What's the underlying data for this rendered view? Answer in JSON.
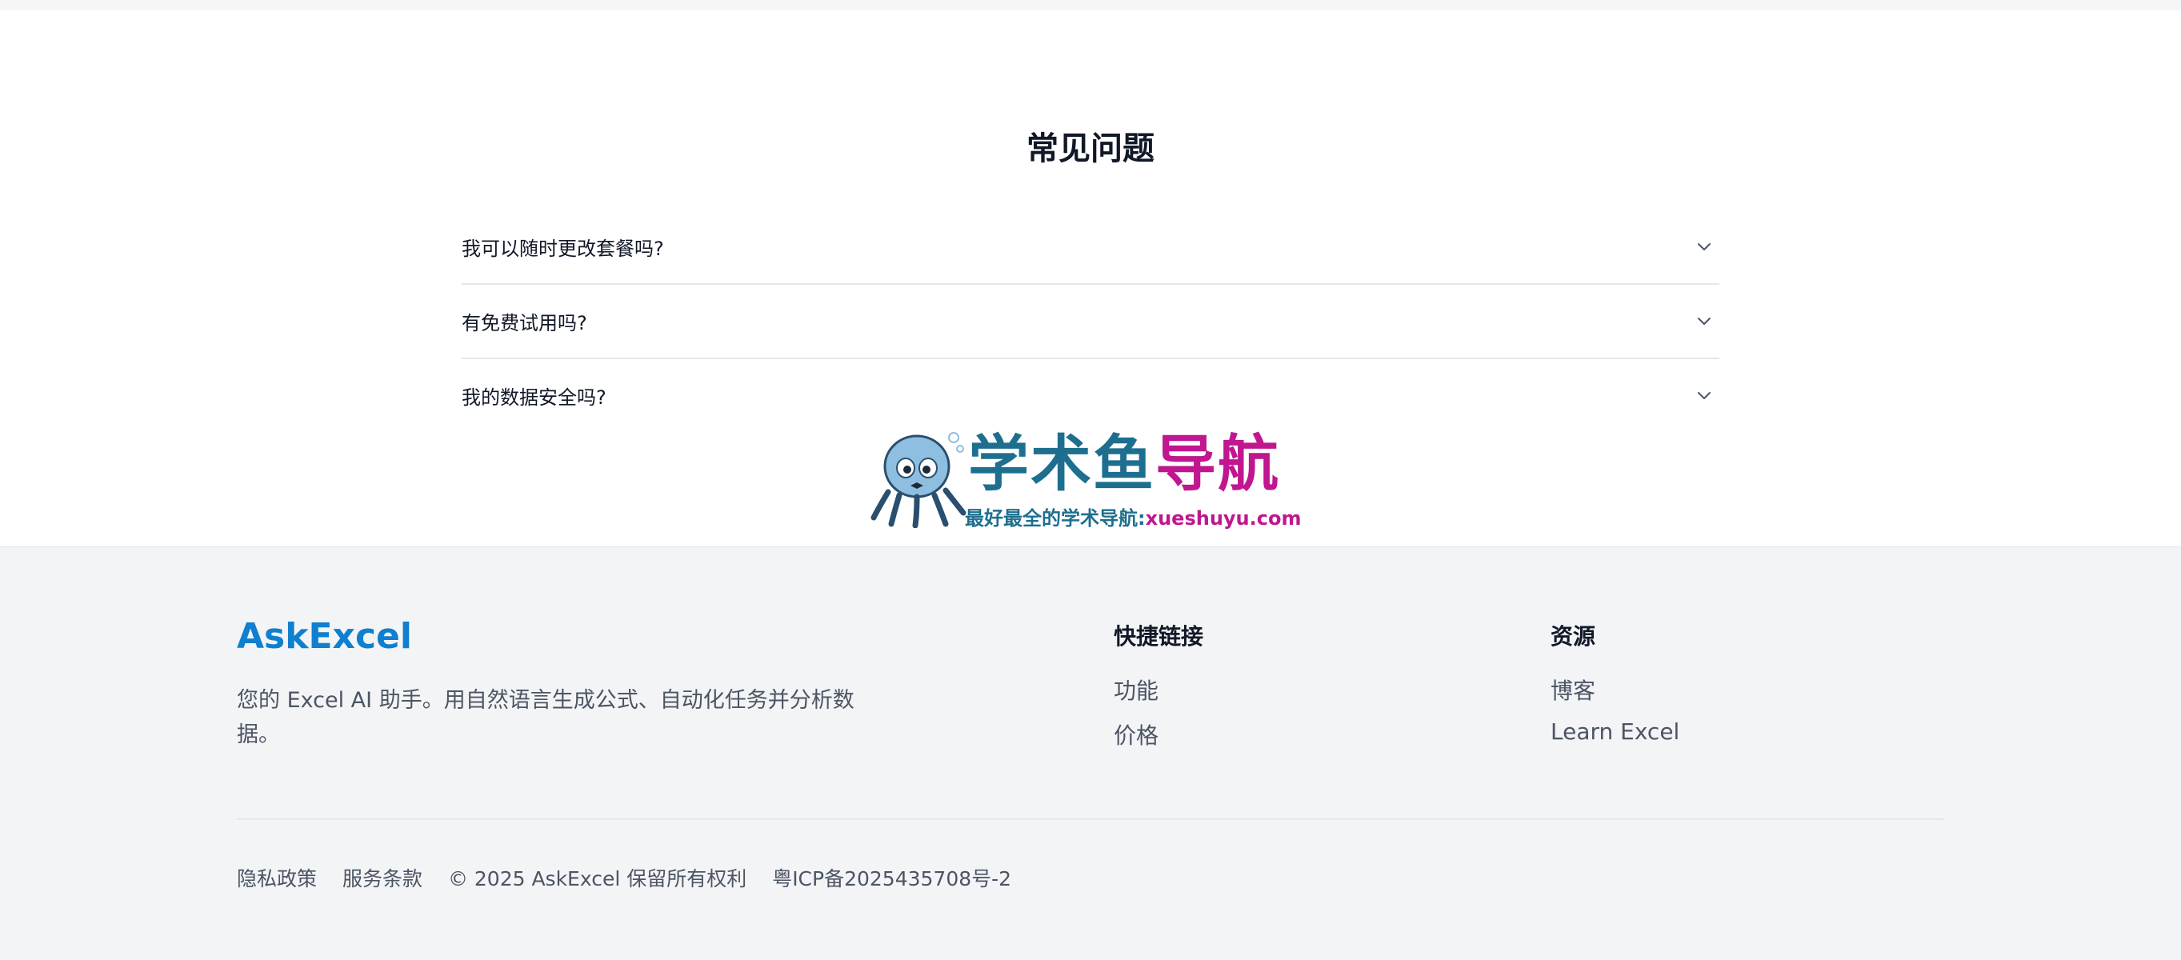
{
  "faq": {
    "title": "常见问题",
    "items": [
      {
        "question": "我可以随时更改套餐吗?"
      },
      {
        "question": "有免费试用吗?"
      },
      {
        "question": "我的数据安全吗?"
      }
    ]
  },
  "watermark": {
    "title_part1": "学术鱼",
    "title_part2": "导航",
    "subtitle_part1": "最好最全的学术导航:",
    "subtitle_part2": "xueshuyu.com"
  },
  "footer": {
    "brand": "AskExcel",
    "description": "您的 Excel AI 助手。用自然语言生成公式、自动化任务并分析数据。",
    "quick_links": {
      "heading": "快捷链接",
      "links": [
        "功能",
        "价格"
      ]
    },
    "resources": {
      "heading": "资源",
      "links": [
        "博客",
        "Learn Excel"
      ]
    },
    "bottom": {
      "privacy": "隐私政策",
      "terms": "服务条款",
      "copyright": "© 2025 AskExcel 保留所有权利",
      "icp": "粤ICP备2025435708号-2"
    }
  },
  "colors": {
    "brand": "#0f7fcf",
    "footer_bg": "#f3f4f6",
    "watermark_blue": "#1e6f8f",
    "watermark_pink": "#c0168f"
  }
}
